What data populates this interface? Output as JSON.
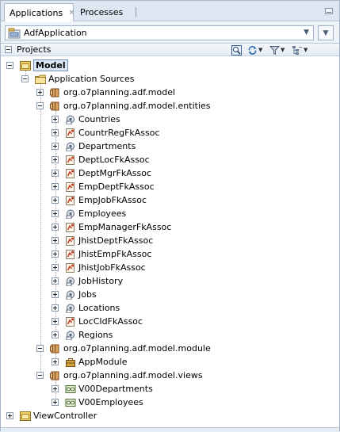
{
  "tabs": {
    "applications": "Applications",
    "processes": "Processes"
  },
  "app_selector": {
    "value": "AdfApplication"
  },
  "projects_panel": {
    "title": "Projects"
  },
  "tree": [
    {
      "label": "Model",
      "level": 0,
      "icon": "project-icon",
      "expander": "minus",
      "selected": true
    },
    {
      "label": "Application Sources",
      "level": 1,
      "icon": "folder-icon",
      "expander": "minus"
    },
    {
      "label": "org.o7planning.adf.model",
      "level": 2,
      "icon": "package-icon",
      "expander": "plus"
    },
    {
      "label": "org.o7planning.adf.model.entities",
      "level": 2,
      "icon": "package-icon",
      "expander": "minus"
    },
    {
      "label": "Countries",
      "level": 3,
      "icon": "entity-object-icon",
      "expander": "plus"
    },
    {
      "label": "CountrRegFkAssoc",
      "level": 3,
      "icon": "association-icon",
      "expander": "plus"
    },
    {
      "label": "Departments",
      "level": 3,
      "icon": "entity-object-icon",
      "expander": "plus"
    },
    {
      "label": "DeptLocFkAssoc",
      "level": 3,
      "icon": "association-icon",
      "expander": "plus"
    },
    {
      "label": "DeptMgrFkAssoc",
      "level": 3,
      "icon": "association-icon",
      "expander": "plus"
    },
    {
      "label": "EmpDeptFkAssoc",
      "level": 3,
      "icon": "association-icon",
      "expander": "plus"
    },
    {
      "label": "EmpJobFkAssoc",
      "level": 3,
      "icon": "association-icon",
      "expander": "plus"
    },
    {
      "label": "Employees",
      "level": 3,
      "icon": "entity-object-icon",
      "expander": "plus"
    },
    {
      "label": "EmpManagerFkAssoc",
      "level": 3,
      "icon": "association-icon",
      "expander": "plus"
    },
    {
      "label": "JhistDeptFkAssoc",
      "level": 3,
      "icon": "association-icon",
      "expander": "plus"
    },
    {
      "label": "JhistEmpFkAssoc",
      "level": 3,
      "icon": "association-icon",
      "expander": "plus"
    },
    {
      "label": "JhistJobFkAssoc",
      "level": 3,
      "icon": "association-icon",
      "expander": "plus"
    },
    {
      "label": "JobHistory",
      "level": 3,
      "icon": "entity-object-icon",
      "expander": "plus"
    },
    {
      "label": "Jobs",
      "level": 3,
      "icon": "entity-object-icon",
      "expander": "plus"
    },
    {
      "label": "Locations",
      "level": 3,
      "icon": "entity-object-icon",
      "expander": "plus"
    },
    {
      "label": "LocCIdFkAssoc",
      "level": 3,
      "icon": "association-icon",
      "expander": "plus"
    },
    {
      "label": "Regions",
      "level": 3,
      "icon": "entity-object-icon",
      "expander": "plus"
    },
    {
      "label": "org.o7planning.adf.model.module",
      "level": 2,
      "icon": "package-icon",
      "expander": "minus"
    },
    {
      "label": "AppModule",
      "level": 3,
      "icon": "application-module-icon",
      "expander": "plus"
    },
    {
      "label": "org.o7planning.adf.model.views",
      "level": 2,
      "icon": "package-icon",
      "expander": "minus"
    },
    {
      "label": "V00Departments",
      "level": 3,
      "icon": "view-object-icon",
      "expander": "plus"
    },
    {
      "label": "V00Employees",
      "level": 3,
      "icon": "view-object-icon",
      "expander": "plus"
    },
    {
      "label": "ViewController",
      "level": 0,
      "icon": "project-icon",
      "expander": "plus"
    }
  ]
}
